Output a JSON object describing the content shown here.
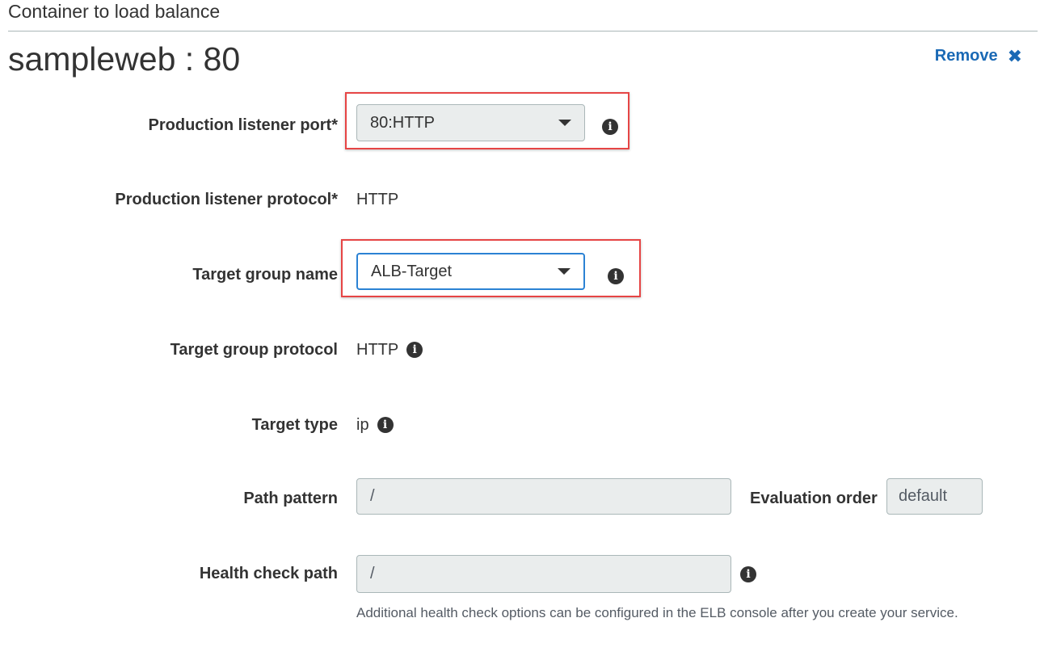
{
  "section": {
    "title": "Container to load balance",
    "container_name": "sampleweb : 80",
    "remove_label": "Remove",
    "remove_icon": "close-icon"
  },
  "fields": {
    "prod_port": {
      "label": "Production listener port*",
      "value": "80:HTTP"
    },
    "prod_protocol": {
      "label": "Production listener protocol*",
      "value": "HTTP"
    },
    "target_group_name": {
      "label": "Target group name",
      "value": "ALB-Target"
    },
    "target_group_protocol": {
      "label": "Target group protocol",
      "value": "HTTP"
    },
    "target_type": {
      "label": "Target type",
      "value": "ip"
    },
    "path_pattern": {
      "label": "Path pattern",
      "value": "/"
    },
    "evaluation_order": {
      "label": "Evaluation order",
      "value": "default"
    },
    "health_check_path": {
      "label": "Health check path",
      "value": "/",
      "hint": "Additional health check options can be configured in the ELB console after you create your service."
    }
  },
  "icons": {
    "info": "i"
  },
  "colors": {
    "link": "#1a69b5",
    "highlight": "#e64545",
    "focus_border": "#2b82d4",
    "disabled_bg": "#eaeded"
  }
}
